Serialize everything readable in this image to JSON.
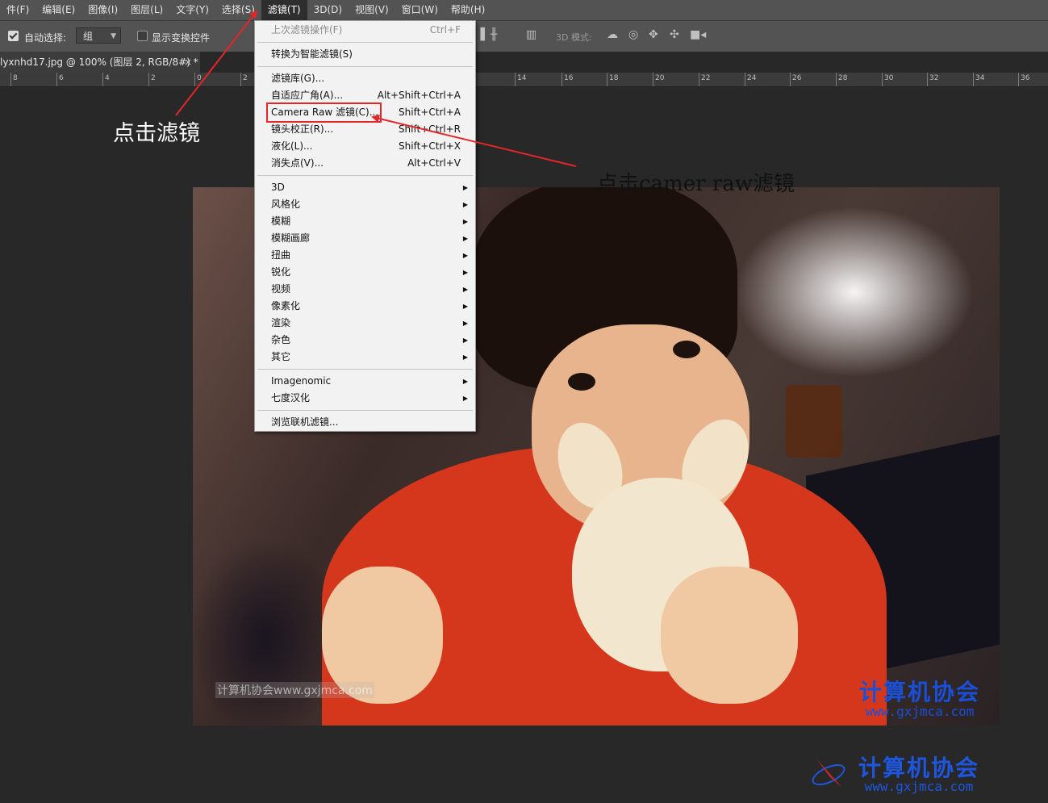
{
  "menubar": {
    "items": [
      "件(F)",
      "编辑(E)",
      "图像(I)",
      "图层(L)",
      "文字(Y)",
      "选择(S)",
      "滤镜(T)",
      "3D(D)",
      "视图(V)",
      "窗口(W)",
      "帮助(H)"
    ],
    "active_index": 6
  },
  "options": {
    "auto_select_label": "自动选择:",
    "auto_select_checked": true,
    "auto_select_value": "组",
    "show_transform_label": "显示变换控件",
    "show_transform_checked": false,
    "mode_3d_label": "3D 模式:"
  },
  "document_tab": {
    "title": "lyxnhd17.jpg @ 100% (图层 2, RGB/8#) *",
    "close": "×"
  },
  "ruler": {
    "labels": [
      "8",
      "6",
      "4",
      "2",
      "0",
      "2",
      "14",
      "16",
      "18",
      "20",
      "22",
      "24",
      "26",
      "28",
      "30",
      "32",
      "34",
      "36"
    ]
  },
  "filter_menu": {
    "items": [
      {
        "label": "上次滤镜操作(F)",
        "shortcut": "Ctrl+F",
        "disabled": true
      },
      {
        "sep": true
      },
      {
        "label": "转换为智能滤镜(S)"
      },
      {
        "sep": true
      },
      {
        "label": "滤镜库(G)..."
      },
      {
        "label": "自适应广角(A)...",
        "shortcut": "Alt+Shift+Ctrl+A"
      },
      {
        "label": "Camera Raw 滤镜(C)...",
        "shortcut": "Shift+Ctrl+A"
      },
      {
        "label": "镜头校正(R)...",
        "shortcut": "Shift+Ctrl+R"
      },
      {
        "label": "液化(L)...",
        "shortcut": "Shift+Ctrl+X"
      },
      {
        "label": "消失点(V)...",
        "shortcut": "Alt+Ctrl+V"
      },
      {
        "sep": true
      },
      {
        "label": "3D",
        "submenu": true
      },
      {
        "label": "风格化",
        "submenu": true
      },
      {
        "label": "模糊",
        "submenu": true
      },
      {
        "label": "模糊画廊",
        "submenu": true
      },
      {
        "label": "扭曲",
        "submenu": true
      },
      {
        "label": "锐化",
        "submenu": true
      },
      {
        "label": "视频",
        "submenu": true
      },
      {
        "label": "像素化",
        "submenu": true
      },
      {
        "label": "渲染",
        "submenu": true
      },
      {
        "label": "杂色",
        "submenu": true
      },
      {
        "label": "其它",
        "submenu": true
      },
      {
        "sep": true
      },
      {
        "label": "Imagenomic",
        "submenu": true
      },
      {
        "label": "七度汉化",
        "submenu": true
      },
      {
        "sep": true
      },
      {
        "label": "浏览联机滤镜..."
      }
    ],
    "highlighted_label": "Camera Raw 滤镜(C)..."
  },
  "annotations": {
    "click_filter": "点击滤镜",
    "click_camera_raw": "点击camer raw滤镜",
    "arrow_color": "#e3262a"
  },
  "watermarks": {
    "photo_text": "计算机协会www.gxjmca.com",
    "logo_cn": "计算机协会",
    "logo_url": "www.gxjmca.com",
    "brand_color": "#1e56df"
  }
}
